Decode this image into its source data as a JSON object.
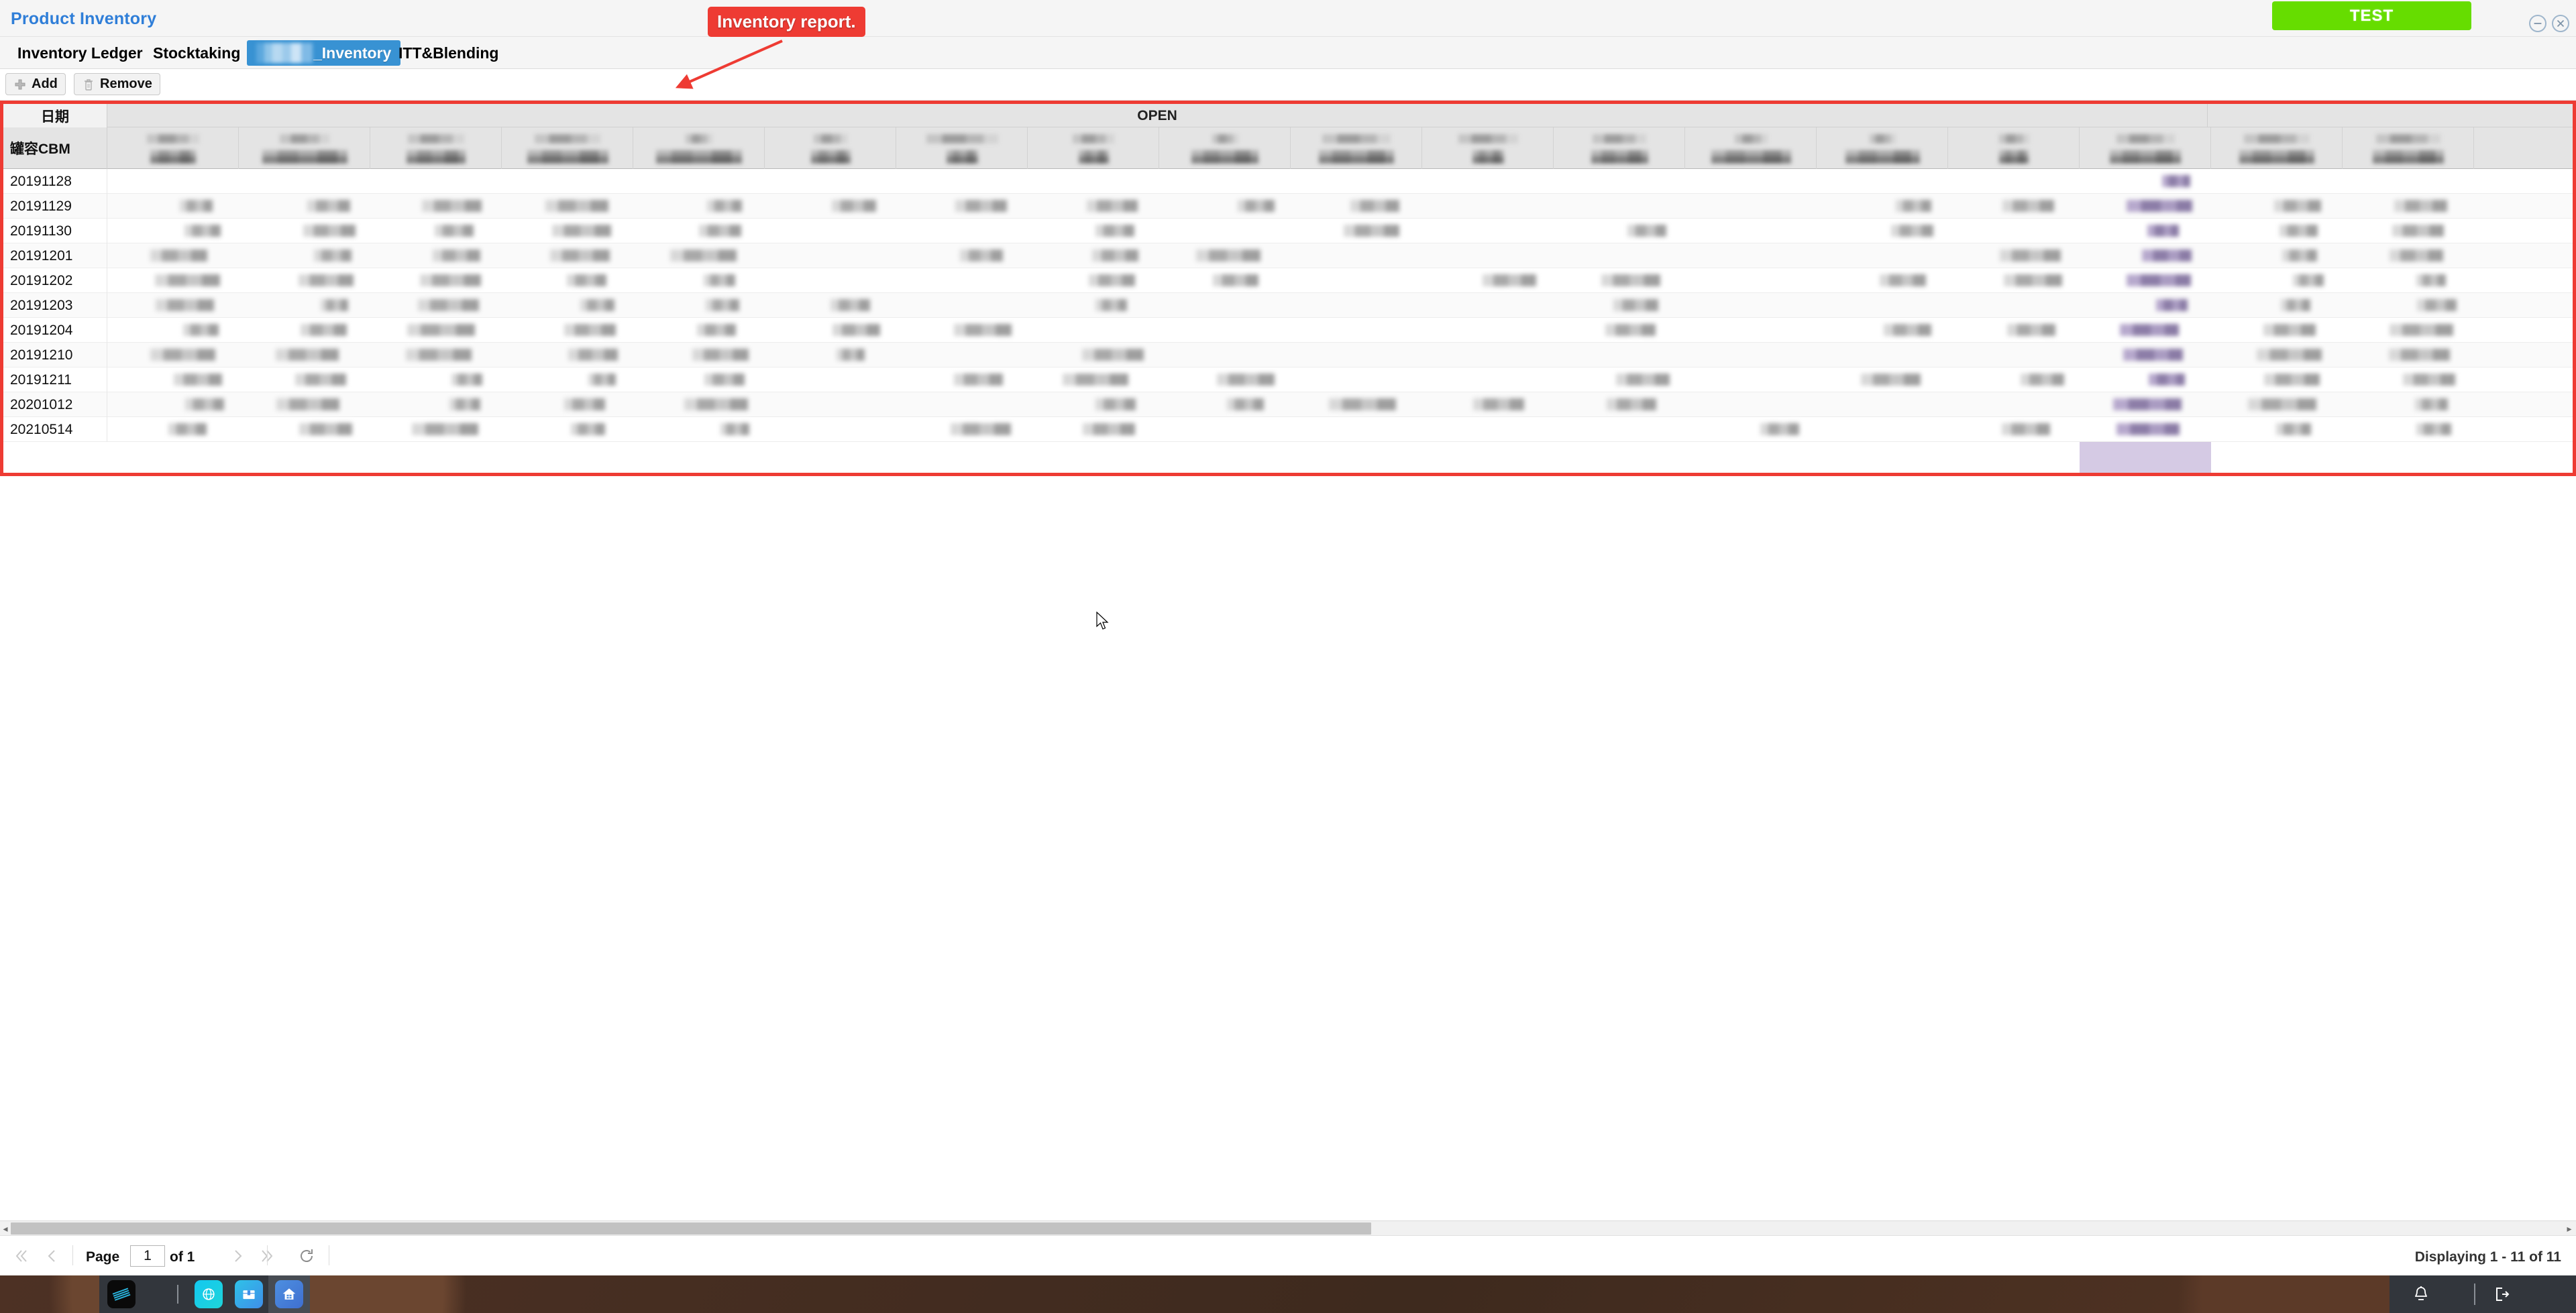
{
  "window": {
    "app_title": "Product Inventory",
    "test_button": "TEST",
    "minimize_icon": "minimize-circle-icon",
    "close_icon": "close-circle-icon"
  },
  "tabs": [
    {
      "label": "Inventory Ledger",
      "active": false
    },
    {
      "label": "Stocktaking",
      "active": false
    },
    {
      "label": "_Inventory",
      "active": true,
      "redacted_prefix": true
    },
    {
      "label": "ITT&Blending",
      "active": false
    }
  ],
  "toolbar": {
    "add_label": "Add",
    "add_icon": "plus-icon",
    "remove_label": "Remove",
    "remove_icon": "trash-icon"
  },
  "annotation": {
    "callout_text": "Inventory report.",
    "callout_color": "#ee3b33",
    "arrow_color": "#ee3b33",
    "border_color": "#ee3b33"
  },
  "grid": {
    "group_header": "OPEN",
    "date_column_header": "日期",
    "cbm_column_header": "罐容CBM",
    "highlight_color": "#d3c7e3",
    "redacted_columns": 18,
    "rows": [
      {
        "date": "20191128"
      },
      {
        "date": "20191129"
      },
      {
        "date": "20191130"
      },
      {
        "date": "20191201"
      },
      {
        "date": "20191202"
      },
      {
        "date": "20191203"
      },
      {
        "date": "20191204"
      },
      {
        "date": "20191210"
      },
      {
        "date": "20191211"
      },
      {
        "date": "20201012"
      },
      {
        "date": "20210514"
      }
    ]
  },
  "pager": {
    "first_icon": "first-page-icon",
    "prev_icon": "prev-page-icon",
    "page_label": "Page",
    "page_value": "1",
    "of_label": "of 1",
    "next_icon": "next-page-icon",
    "last_icon": "last-page-icon",
    "refresh_icon": "refresh-icon",
    "display_text": "Displaying 1 - 11 of 11"
  },
  "taskbar": {
    "items": [
      {
        "name": "ibm-icon"
      },
      {
        "name": "browser-globe-icon"
      },
      {
        "name": "box-icon"
      },
      {
        "name": "home-icon"
      }
    ],
    "bell_icon": "bell-icon",
    "logout_icon": "logout-icon"
  }
}
